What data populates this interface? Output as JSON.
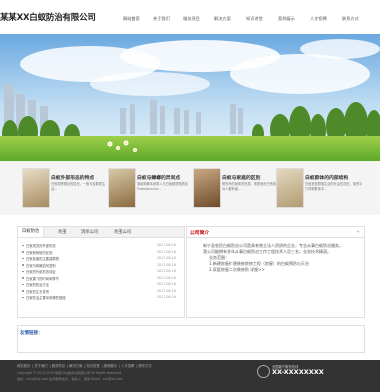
{
  "site": {
    "logo_text": "某某XX白蚁防治有限公司"
  },
  "nav": [
    "网站首页",
    "关于我们",
    "服务项目",
    "解决方案",
    "知识讲堂",
    "案例展示",
    "人才招聘",
    "联系方式"
  ],
  "promos": [
    {
      "title": "白蚁外部形态的特点",
      "text": "白蚁属等翅目的昆虫，一般长及群居生活..."
    },
    {
      "title": "白蚁与蟑螂的异同点",
      "text": "涤除蟑螂本身带入与白蚁都是物质及Protuberance..."
    },
    {
      "title": "白蚁与家庭的区别",
      "text": "蟹内外的身体的虫属，蛋里面在已有蚁属对人都有害..."
    },
    {
      "title": "白蚁群体的内部结构",
      "text": "白蚁是营群落生活的社会性昆虫，某些平行同种群体中..."
    }
  ],
  "news": {
    "tabs": [
      "白蚁防治",
      "杀虫",
      "消杀公司",
      "杀虫公司"
    ],
    "items": [
      {
        "title": "白蚁成虫的外部形态",
        "date": "2017-08-16"
      },
      {
        "title": "白蚁和蚂蚁的区别",
        "date": "2017-08-16"
      },
      {
        "title": "白蚁危害的主要建筑物",
        "date": "2017-08-16"
      },
      {
        "title": "白蚁与蟑螂如何鉴别",
        "date": "2017-08-16"
      },
      {
        "title": "白蚁的外部形态特征",
        "date": "2017-08-16"
      },
      {
        "title": "白蚁婚飞的时间和季节",
        "date": "2017-08-16"
      },
      {
        "title": "白蚁的防治方法",
        "date": "2017-08-16"
      },
      {
        "title": "白蚁的生长发育",
        "date": "2017-08-16"
      },
      {
        "title": "白蚁防治主要采用哪些措施",
        "date": "2017-08-16"
      }
    ]
  },
  "about": {
    "title": "公司简介",
    "more": "+",
    "paragraphs": [
      "新宁县农民白蚁防治公司是具有独立法人资质的企业，专业从事白蚁防治服务。",
      "我公司能拥有多年从事白蚁防治工作工程技术人员三名，业务技术精湛。"
    ],
    "scope_title": "业务范围：",
    "scope": [
      "1.新建房屋扩建装修房修工程（房屋）的白蚁预防与灭治",
      "2.家庭房屋二次装修防  详细>>"
    ]
  },
  "links": {
    "title": "友情链接："
  },
  "footer": {
    "nav": [
      "网站首页",
      "关于我们",
      "服务项目",
      "解决方案",
      "知识讲堂",
      "案例展示",
      "人才招聘",
      "联系方式"
    ],
    "copyright": "Copyright © 2015-2016 某某XX白蚁防治有限公司  All Rights Reserved",
    "contact": "地址：xxxx@xx.com  技术服务热线：  联系人：某某  Email：xxx@xx.com",
    "hotline_label": "全国客户服务热线",
    "hotline_number": "XX-XXXXXXXX"
  },
  "colors": {
    "accent": "#cc0000",
    "footer_bg": "#333333",
    "link_title": "#3366aa"
  }
}
